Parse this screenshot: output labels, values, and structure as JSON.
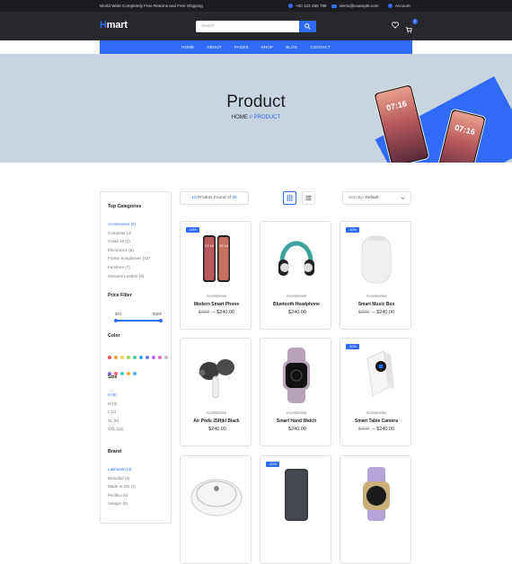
{
  "topbar": {
    "message": "World Wide Completely Free Returns and Free Shipping",
    "phone": "+00 123 456 789",
    "email": "demo@example.com",
    "account": "Account"
  },
  "header": {
    "logo_h": "H",
    "logo_rest": "mart",
    "search_placeholder": "Search",
    "cart_count": "0"
  },
  "nav": [
    "HOME",
    "ABOUT",
    "PAGES",
    "SHOP",
    "BLOG",
    "CONTACT"
  ],
  "hero": {
    "title": "Product",
    "crumb_home": "HOME",
    "crumb_sep": " // ",
    "crumb_current": "PRODUCT",
    "phone_time": "07:16"
  },
  "toolbar": {
    "count_num": "10",
    "count_text": " Product Found of ",
    "count_total": "30",
    "sort_label": "Sort By:",
    "sort_value": "Default"
  },
  "sidebar": {
    "categories_title": "Top Categories",
    "categories": [
      "Accessories (6)",
      "Computer (4)",
      "Covid-19 (2)",
      "Electronics (6)",
      "Frame Sunglasses (12)",
      "Furniture (7)",
      "Genuine Leather (9)"
    ],
    "price_title": "Price Filter",
    "price_min": "$10",
    "price_max": "$300",
    "color_title": "Color",
    "colors": [
      "#e55353",
      "#f39c3d",
      "#f1d54a",
      "#9ad65c",
      "#4cc9a6",
      "#3ea6e8",
      "#6b7cf0",
      "#b96ae8",
      "#e96ab8",
      "#c2c2c2",
      "#8b6ee8",
      "#ec5f85",
      "#3bd1c3",
      "#f5a742",
      "#5aa8f0"
    ],
    "size_title": "Size",
    "sizes": [
      "S (6)",
      "M (4)",
      "L (2)",
      "XL (6)",
      "XXL (12)"
    ],
    "brand_title": "Brand",
    "brands": [
      "Lakmeeto (4)",
      "Beautiful (4)",
      "Made In GD (2)",
      "Pecifico (6)",
      "Xiaugsr (9)"
    ]
  },
  "products": [
    {
      "badge": "-10%",
      "category": "Accessories",
      "name": "Modern Smart Phone",
      "old_price": "$300",
      "sep": " – ",
      "price": "$240.00",
      "icon": "smartphone-icon"
    },
    {
      "badge": "",
      "category": "Accessories",
      "name": "Bluetooth Headphone",
      "old_price": "",
      "sep": "",
      "price": "$240.00",
      "icon": "headphone-icon"
    },
    {
      "badge": "-10%",
      "category": "Accessories",
      "name": "Smart Music Box",
      "old_price": "$300",
      "sep": " – ",
      "price": "$240.00",
      "icon": "speaker-icon"
    },
    {
      "badge": "",
      "category": "Accessories",
      "name": "Air Pods 25Hjkl Black",
      "old_price": "",
      "sep": "",
      "price": "$240.00",
      "icon": "earbuds-icon"
    },
    {
      "badge": "",
      "category": "Accessories",
      "name": "Smart Hand Watch",
      "old_price": "",
      "sep": "",
      "price": "$240.00",
      "icon": "watch-icon"
    },
    {
      "badge": "-10%",
      "category": "Accessories",
      "name": "Smart Table Camera",
      "old_price": "$300",
      "sep": " – ",
      "price": "$240.00",
      "icon": "camera-icon"
    },
    {
      "badge": "",
      "category": "",
      "name": "",
      "old_price": "",
      "sep": "",
      "price": "",
      "icon": "robot-vacuum-icon"
    },
    {
      "badge": "-10%",
      "category": "",
      "name": "",
      "old_price": "",
      "sep": "",
      "price": "",
      "icon": "power-bank-icon"
    },
    {
      "badge": "",
      "category": "",
      "name": "",
      "old_price": "",
      "sep": "",
      "price": "",
      "icon": "smartwatch-icon"
    }
  ]
}
